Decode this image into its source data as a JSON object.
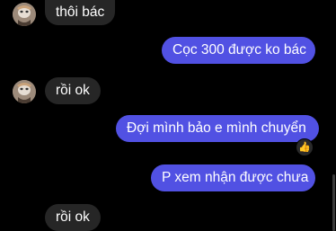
{
  "messages": [
    {
      "text": "thôi bác",
      "direction": "incoming"
    },
    {
      "text": "Cọc 300 được ko bác",
      "direction": "outgoing"
    },
    {
      "text": "rồi ok",
      "direction": "incoming"
    },
    {
      "text": "Đợi mình bảo e mình chuyển",
      "direction": "outgoing",
      "reaction": "👍"
    },
    {
      "text": "P xem nhận được chưa",
      "direction": "outgoing"
    },
    {
      "text": "rồi ok",
      "direction": "incoming"
    }
  ],
  "colors": {
    "background": "#000000",
    "incoming_bubble": "#262626",
    "outgoing_bubble": "#5151e3",
    "text": "#ffffff"
  },
  "icons": {
    "avatar": "contact-avatar-icon",
    "reaction": "thumbs-up-icon"
  }
}
